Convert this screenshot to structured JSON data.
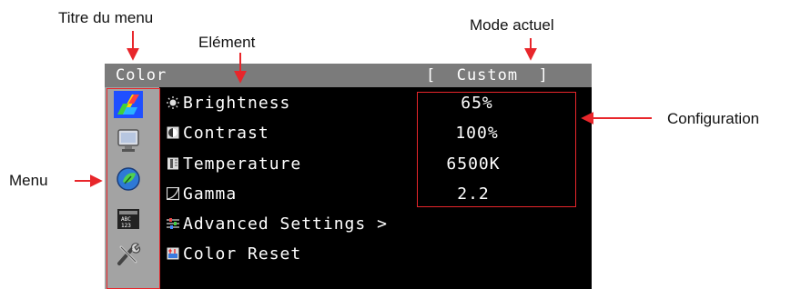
{
  "annotations": {
    "menu_title": "Titre du menu",
    "element": "Elément",
    "current_mode": "Mode actuel",
    "configuration": "Configuration",
    "menu": "Menu"
  },
  "osd": {
    "title": "Color",
    "mode": "[  Custom  ]",
    "sidebar_icons": [
      "color-icon",
      "screen-icon",
      "power-eco-icon",
      "language-icon",
      "tools-icon"
    ],
    "items": [
      {
        "label": "Brightness",
        "icon": "brightness-icon",
        "value": "65%"
      },
      {
        "label": "Contrast",
        "icon": "contrast-icon",
        "value": "100%"
      },
      {
        "label": "Temperature",
        "icon": "temperature-icon",
        "value": "6500K"
      },
      {
        "label": "Gamma",
        "icon": "gamma-icon",
        "value": "2.2"
      },
      {
        "label": "Advanced Settings >",
        "icon": "advanced-settings-icon"
      },
      {
        "label": "Color Reset",
        "icon": "color-reset-icon"
      }
    ],
    "colors": {
      "accent_red": "#e8262b",
      "titlebar": "#7b7b7b",
      "sidebar": "#a3a3a3",
      "selected": "#1f4fff"
    }
  }
}
